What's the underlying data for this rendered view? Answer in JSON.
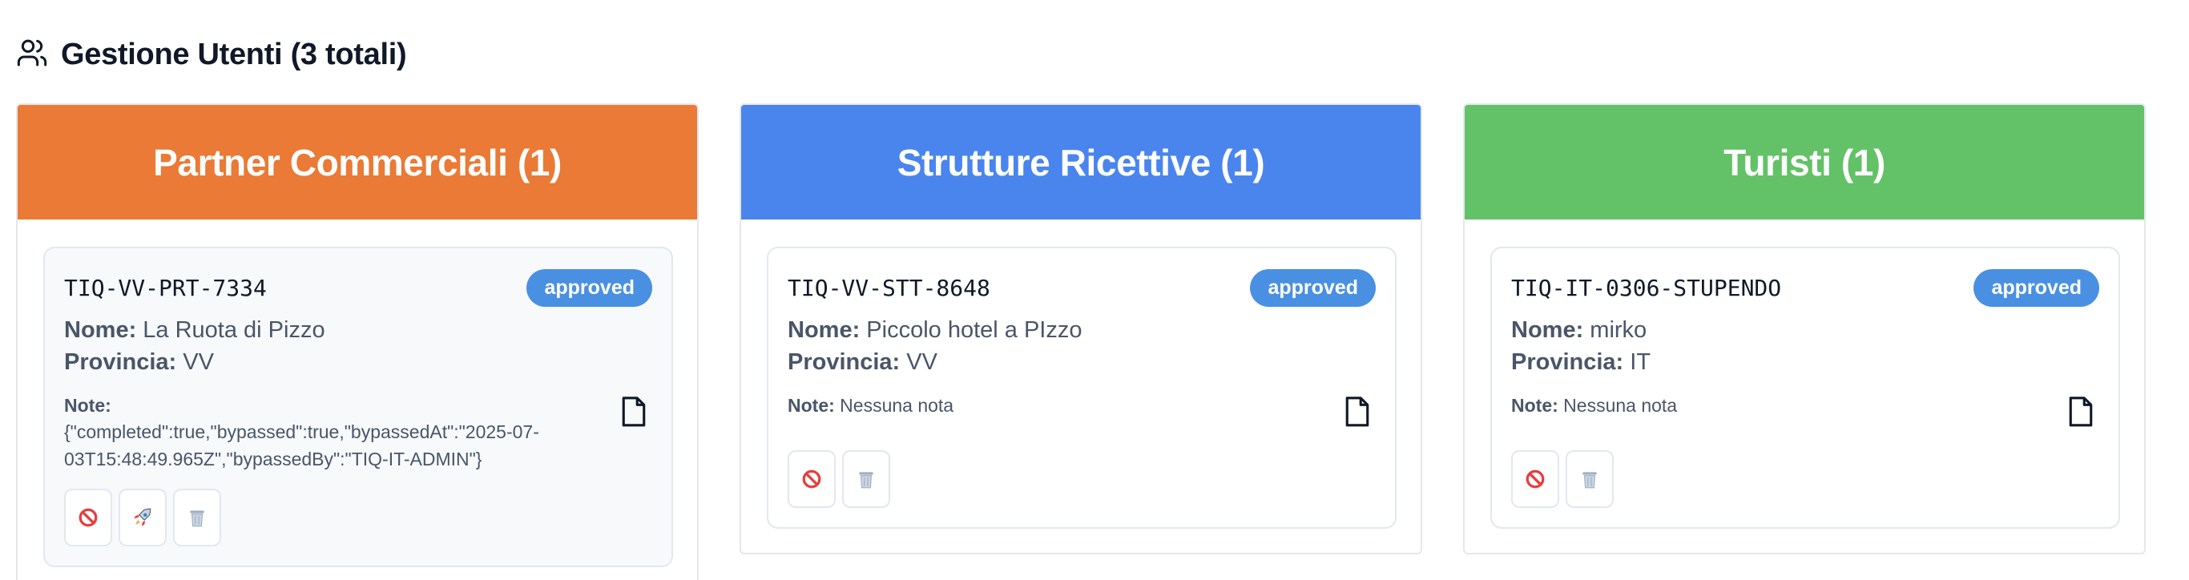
{
  "page": {
    "title": "Gestione Utenti (3 totali)",
    "icon": "users-icon"
  },
  "colors": {
    "partner": "#ea7a35",
    "strutture": "#4a85ee",
    "turisti": "#63c267",
    "badge": "#4a90e2"
  },
  "labels": {
    "nome": "Nome:",
    "provincia": "Provincia:",
    "note": "Note:"
  },
  "columns": [
    {
      "title": "Partner Commerciali (1)",
      "card": {
        "id": "TIQ-VV-PRT-7334",
        "status": "approved",
        "nome": "La Ruota di Pizzo",
        "provincia": "VV",
        "note": "{\"completed\":true,\"bypassed\":true,\"bypassedAt\":\"2025-07-03T15:48:49.965Z\",\"bypassedBy\":\"TIQ-IT-ADMIN\"}",
        "actions": [
          "block-icon",
          "rocket-icon",
          "trash-icon"
        ]
      }
    },
    {
      "title": "Strutture Ricettive (1)",
      "card": {
        "id": "TIQ-VV-STT-8648",
        "status": "approved",
        "nome": "Piccolo hotel a PIzzo",
        "provincia": "VV",
        "note": "Nessuna nota",
        "actions": [
          "block-icon",
          "trash-icon"
        ]
      }
    },
    {
      "title": "Turisti (1)",
      "card": {
        "id": "TIQ-IT-0306-STUPENDO",
        "status": "approved",
        "nome": "mirko",
        "provincia": "IT",
        "note": "Nessuna nota",
        "actions": [
          "block-icon",
          "trash-icon"
        ]
      }
    }
  ]
}
